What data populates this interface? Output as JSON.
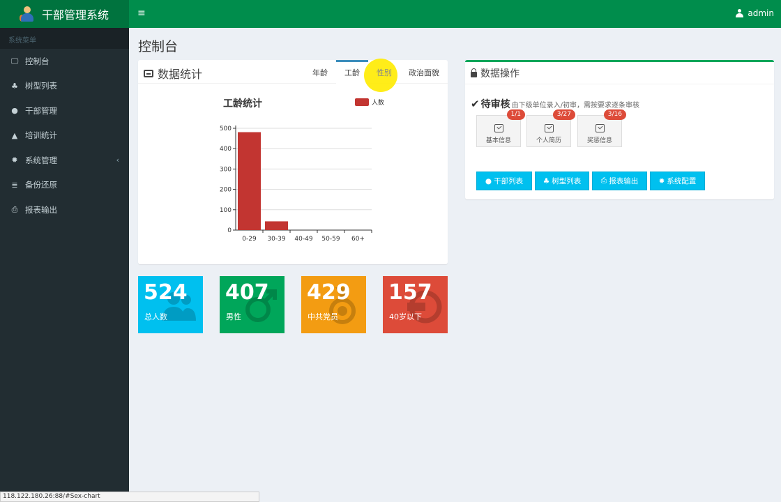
{
  "app": {
    "title": "干部管理系统",
    "user": "admin"
  },
  "sidebar": {
    "header": "系统菜单",
    "items": [
      {
        "label": "控制台",
        "icon": "monitor-icon"
      },
      {
        "label": "树型列表",
        "icon": "tree-icon"
      },
      {
        "label": "干部管理",
        "icon": "users-icon"
      },
      {
        "label": "培训统计",
        "icon": "graduation-cap-icon"
      },
      {
        "label": "系统管理",
        "icon": "gear-icon"
      },
      {
        "label": "备份还原",
        "icon": "database-icon"
      },
      {
        "label": "报表输出",
        "icon": "printer-icon"
      }
    ]
  },
  "page": {
    "title": "控制台"
  },
  "stats": {
    "title": "数据统计",
    "tabs": [
      "年龄",
      "工龄",
      "性别",
      "政治面貌"
    ],
    "active_tab": 1
  },
  "chart_data": {
    "type": "bar",
    "title": "工龄统计",
    "categories": [
      "0-29",
      "30-39",
      "40-49",
      "50-59",
      "60+"
    ],
    "series": [
      {
        "name": "人数",
        "values": [
          481,
          43,
          0,
          0,
          0
        ],
        "color": "#c23531"
      }
    ],
    "ylim": [
      0,
      500
    ],
    "yticks": [
      0,
      100,
      200,
      300,
      400,
      500
    ],
    "grid": true,
    "legend": "top-right"
  },
  "ops": {
    "title": "数据操作",
    "pending_title": "待审核",
    "pending_desc": "由下级单位录入/初审，需按要求逐条审核",
    "cards": [
      {
        "label": "基本信息",
        "badge": "1/1"
      },
      {
        "label": "个人简历",
        "badge": "3/27"
      },
      {
        "label": "奖惩信息",
        "badge": "3/16"
      }
    ],
    "buttons": [
      {
        "label": "干部列表",
        "icon": "users-icon"
      },
      {
        "label": "树型列表",
        "icon": "tree-icon"
      },
      {
        "label": "报表输出",
        "icon": "printer-icon"
      },
      {
        "label": "系统配置",
        "icon": "gear-icon"
      }
    ]
  },
  "tiles": [
    {
      "value": "524",
      "label": "总人数",
      "color": "#00c0ef",
      "icon": "users-icon"
    },
    {
      "value": "407",
      "label": "男性",
      "color": "#00a65a",
      "icon": "male-icon"
    },
    {
      "value": "429",
      "label": "中共党员",
      "color": "#f39c12",
      "icon": "medal-icon"
    },
    {
      "value": "157",
      "label": "40岁以下",
      "color": "#dd4b39",
      "icon": "youth-icon"
    }
  ],
  "status_url": "118.122.180.26:88/#Sex-chart"
}
